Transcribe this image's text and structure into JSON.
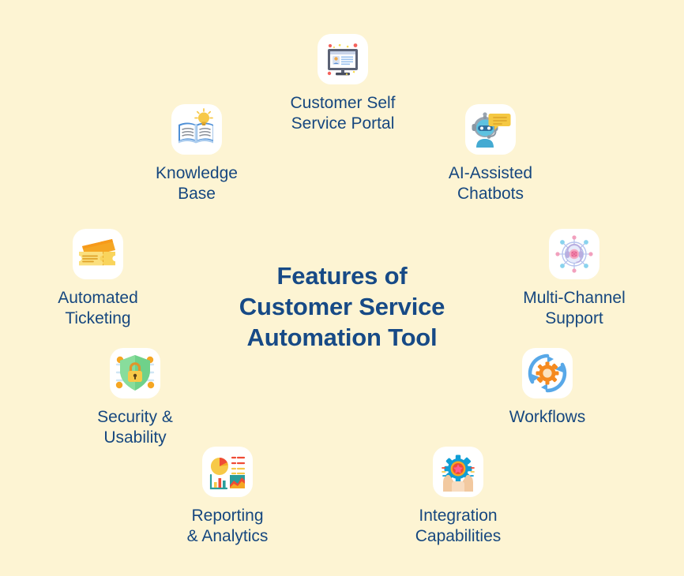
{
  "page": {
    "background_color": "#fdf4d3",
    "text_color": "#16477f",
    "tile_color": "#ffffff",
    "title": "Features of\nCustomer Service\nAutomation Tool"
  },
  "features": [
    {
      "id": "customer-self-service-portal",
      "label": "Customer Self\nService Portal",
      "icon": "monitor-user-portal-icon"
    },
    {
      "id": "knowledge-base",
      "label": "Knowledge\nBase",
      "icon": "open-book-lightbulb-icon"
    },
    {
      "id": "ai-assisted-chatbots",
      "label": "AI-Assisted\nChatbots",
      "icon": "chatbot-robot-icon"
    },
    {
      "id": "automated-ticketing",
      "label": "Automated\nTicketing",
      "icon": "tickets-icon"
    },
    {
      "id": "multi-channel-support",
      "label": "Multi-Channel\nSupport",
      "icon": "network-headset-hub-icon"
    },
    {
      "id": "security-usability",
      "label": "Security &\nUsability",
      "icon": "shield-padlock-icon"
    },
    {
      "id": "workflows",
      "label": "Workflows",
      "icon": "gear-refresh-arrows-icon"
    },
    {
      "id": "reporting-analytics",
      "label": "Reporting\n& Analytics",
      "icon": "charts-analytics-icon"
    },
    {
      "id": "integration-capabilities",
      "label": "Integration\nCapabilities",
      "icon": "hands-gear-star-icon"
    }
  ]
}
